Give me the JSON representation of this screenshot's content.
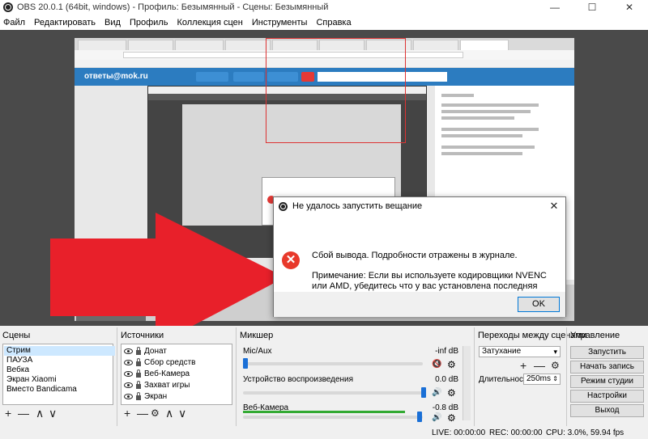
{
  "window": {
    "title": "OBS 20.0.1 (64bit, windows) - Профиль: Безымянный - Сцены: Безымянный",
    "minimize": "—",
    "maximize": "☐",
    "close": "✕"
  },
  "menu": [
    "Файл",
    "Редактировать",
    "Вид",
    "Профиль",
    "Коллекция сцен",
    "Инструменты",
    "Справка"
  ],
  "preview": {
    "captured_site_logo": "ответы@mok.ru"
  },
  "dialog": {
    "title": "Не удалось запустить вещание",
    "message": "Сбой вывода. Подробности отражены в журнале.",
    "note": "Примечание: Если вы используете кодировщики NVENC или AMD, убедитесь что у вас установлена последняя версия видеорайвера.",
    "ok": "OK",
    "close": "✕",
    "error_icon": "✕"
  },
  "scenes": {
    "title": "Сцены",
    "items": [
      "Стрим",
      "ПАУЗА",
      "Вебка",
      "Экран Xiaomi",
      "Вместо Bandicama"
    ],
    "selected": 0
  },
  "sources": {
    "title": "Источники",
    "items": [
      "Донат",
      "Сбор средств",
      "Веб-Камера",
      "Захват игры",
      "Экран"
    ]
  },
  "mixer": {
    "title": "Микшер",
    "channels": [
      {
        "name": "Mic/Aux",
        "db": "-inf dB",
        "muted": true,
        "level": 0.0
      },
      {
        "name": "Устройство воспроизведения",
        "db": "0.0 dB",
        "muted": false,
        "level": 1.0
      },
      {
        "name": "Веб-Камера",
        "db": "-0.8 dB",
        "muted": false,
        "level": 0.97
      }
    ]
  },
  "transitions": {
    "title": "Переходы между сценами",
    "selected": "Затухание",
    "duration_label": "Длительность",
    "duration": "250ms"
  },
  "controls": {
    "title": "Управление",
    "buttons": [
      "Запустить трансляцию",
      "Начать запись",
      "Режим студии",
      "Настройки",
      "Выход"
    ]
  },
  "status": {
    "live": "LIVE: 00:00:00",
    "rec": "REC: 00:00:00",
    "cpu": "CPU: 3.0%, 59.94 fps"
  },
  "toolbar_glyphs": {
    "add": "+",
    "remove": "—",
    "up": "∧",
    "down": "∨",
    "gear": "⚙"
  },
  "colors": {
    "arrow": "#e8202a",
    "accent": "#1a6fd6",
    "error": "#e8392b"
  }
}
